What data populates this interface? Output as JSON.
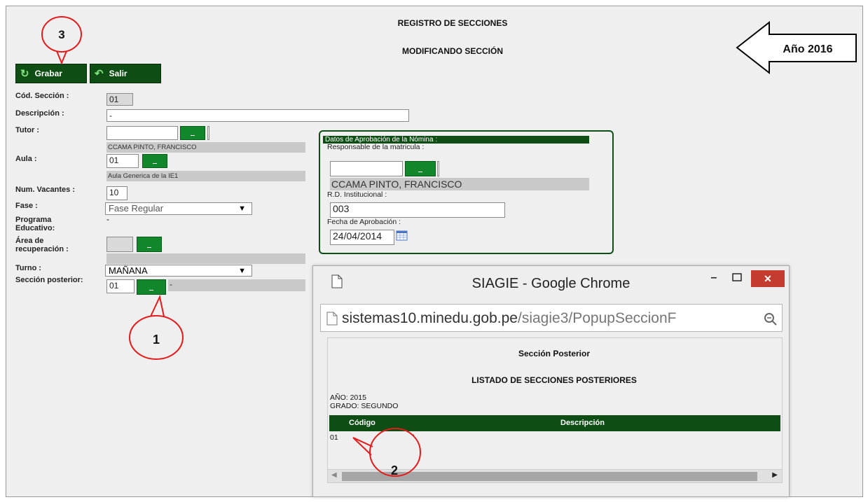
{
  "header": {
    "title": "REGISTRO DE SECCIONES",
    "subtitle": "MODIFICANDO SECCIÓN",
    "year_note": "Año 2016"
  },
  "toolbar": {
    "save_label": "Grabar",
    "exit_label": "Salir"
  },
  "form": {
    "cod_seccion_label": "Cód. Sección :",
    "cod_seccion_value": "01",
    "descripcion_label": "Descripción :",
    "descripcion_value": "-",
    "tutor_label": "Tutor :",
    "tutor_value": "",
    "tutor_name": "CCAMA PINTO, FRANCISCO",
    "aula_label": "Aula :",
    "aula_value": "01",
    "aula_name": "Aula Generica de la IE1",
    "vacantes_label": "Num. Vacantes :",
    "vacantes_value": "10",
    "fase_label": "Fase :",
    "fase_value": "Fase Regular",
    "programa_label": "Programa Educativo:",
    "programa_value": "-",
    "area_label": "Área de recuperación :",
    "area_value": "",
    "turno_label": "Turno :",
    "turno_value": "MAÑANA",
    "seccion_post_label": "Sección posterior:",
    "seccion_post_value": "01",
    "seccion_post_desc": "-",
    "lookup_button_label": "..."
  },
  "nomina": {
    "header": "Datos de Aprobación de la Nómina :",
    "responsable_label": "Responsable de la matricula :",
    "responsable_value": "",
    "responsable_name": "CCAMA PINTO, FRANCISCO",
    "rd_label": "R.D. Institucional :",
    "rd_value": "003",
    "fecha_label": "Fecha de Aprobación :",
    "fecha_value": "24/04/2014"
  },
  "popup": {
    "window_title": "SIAGIE - Google Chrome",
    "url_host": "sistemas10.minedu.gob.pe",
    "url_path": "/siagie3/PopupSeccionF",
    "page_title": "Sección Posterior",
    "list_title": "LISTADO DE SECCIONES POSTERIORES",
    "year_line": "AÑO: 2015",
    "grade_line": "GRADO: SEGUNDO",
    "columns": [
      "Código",
      "Descripción"
    ],
    "rows": [
      {
        "codigo": "01",
        "descripcion": "-"
      }
    ]
  },
  "callouts": {
    "one": "1",
    "two": "2",
    "three": "3"
  },
  "colors": {
    "dark_green": "#0e4d14",
    "button_green": "#11862a",
    "callout_red": "#e51b1b",
    "close_red": "#c43c30"
  }
}
